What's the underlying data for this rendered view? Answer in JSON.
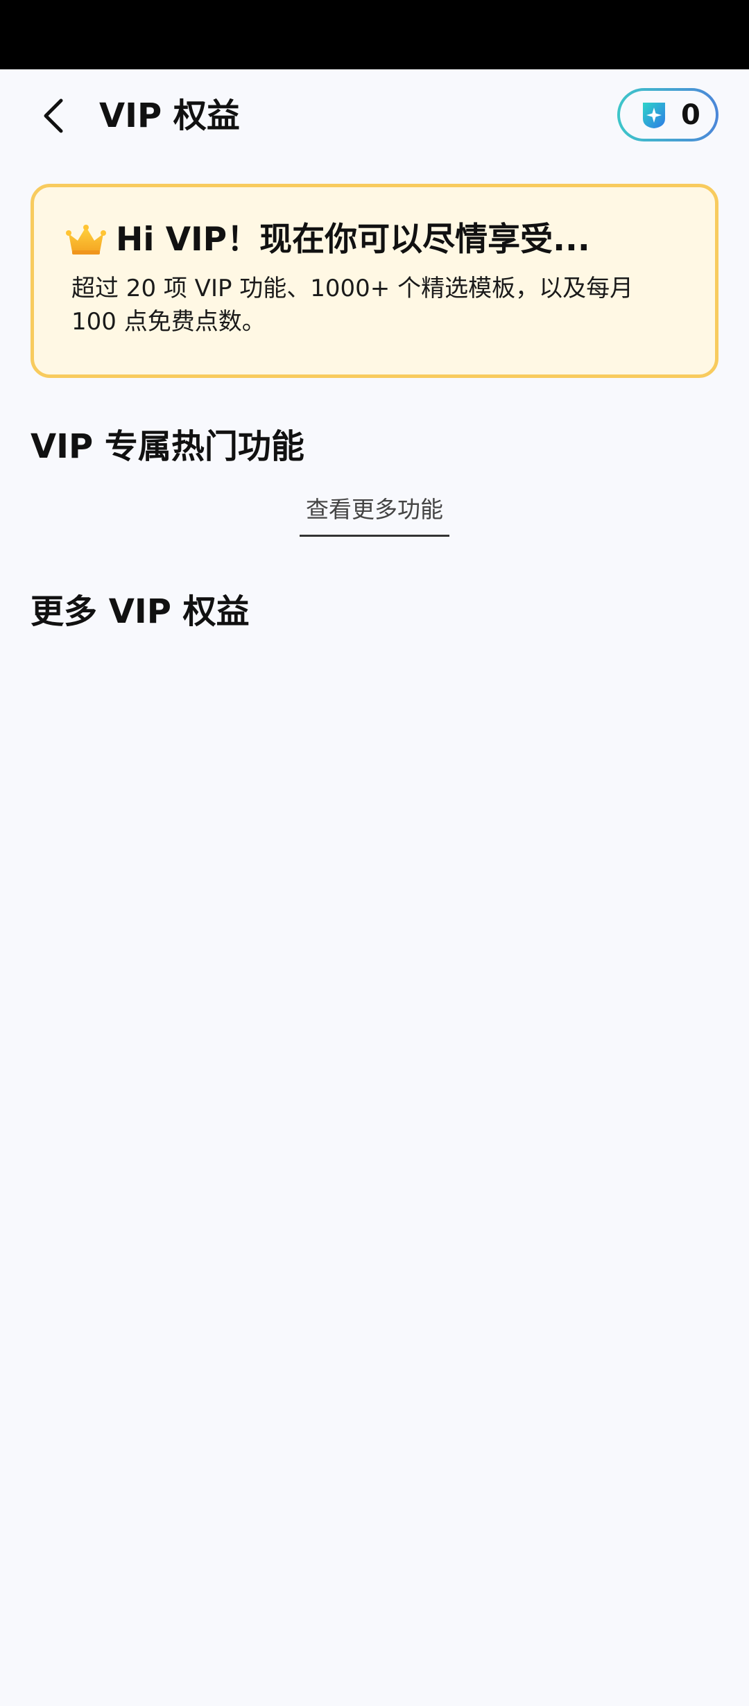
{
  "header": {
    "title": "VIP 权益",
    "points_value": "0"
  },
  "vip_card": {
    "title": "Hi VIP！现在你可以尽情享受...",
    "description": "超过 20 项 VIP 功能、1000+ 个精选模板，以及每月 100 点免费点数。"
  },
  "sections": {
    "hot_features_title": "VIP 专属热门功能",
    "see_more_label": "查看更多功能",
    "more_benefits_title": "更多 VIP 权益"
  },
  "colors": {
    "background": "#F8F9FD",
    "card_background": "#FFF8E4",
    "card_border": "#F8CB5E",
    "points_gradient_start": "#3EC6C9",
    "points_gradient_end": "#4B86D8"
  },
  "icons": {
    "back": "chevron-left-icon",
    "points": "sparkle-shield-icon",
    "crown": "crown-icon"
  }
}
